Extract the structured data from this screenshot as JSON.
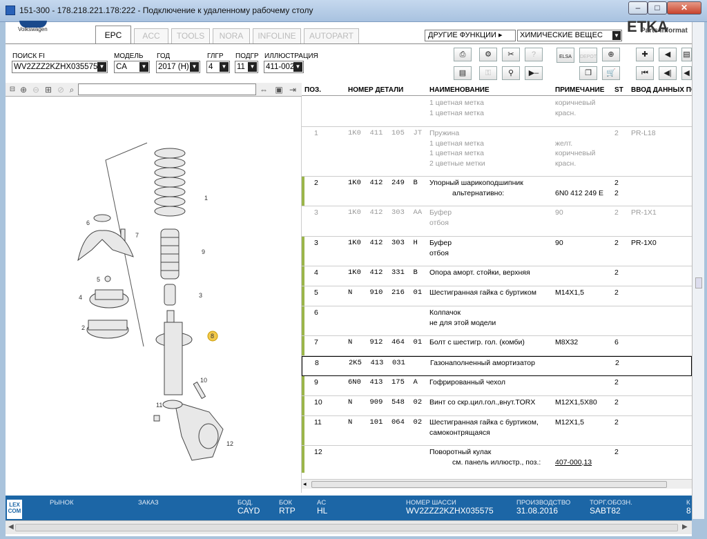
{
  "window": {
    "title": "151-300 - 178.218.221.178:222 - Подключение к удаленному рабочему столу",
    "btn_min": "–",
    "btn_max": "□",
    "btn_close": "✕"
  },
  "brand": {
    "name": "Volkswagen",
    "right_text": "Parts Informat",
    "right_logo": "ETKA"
  },
  "tabs": [
    "EPC",
    "ACC",
    "TOOLS",
    "NORA",
    "INFOLINE",
    "AUTOPART"
  ],
  "other_functions": {
    "label": "ДРУГИЕ ФУНКЦИИ ▸",
    "value": "ХИМИЧЕСКИЕ ВЕЩЕС"
  },
  "filters": [
    {
      "label": "ПОИСК FI",
      "value": "WV2ZZZ2KZHX035575"
    },
    {
      "label": "МОДЕЛЬ",
      "value": "CA"
    },
    {
      "label": "ГОД",
      "value": "2017 (H)"
    },
    {
      "label": "ГЛГР",
      "value": "4"
    },
    {
      "label": "ПОДГР",
      "value": "11"
    },
    {
      "label": "ИЛЛЮСТРАЦИЯ",
      "value": "411-002"
    }
  ],
  "toolbar_labels": {
    "elsa": "ELSA",
    "depot": "DEPOT"
  },
  "columns": [
    "ПОЗ.",
    "НОМЕР ДЕТАЛИ",
    "НАИМЕНОВАНИЕ",
    "ПРИМЕЧАНИЕ",
    "ST",
    "ВВОД ДАННЫХ ПО"
  ],
  "rows": [
    {
      "pos": "",
      "part": "",
      "name": "1 цветная метка\n1 цветная метка",
      "note": "коричневый\nкрасн.",
      "st": "",
      "input": "",
      "style": "gray"
    },
    {
      "pos": "1",
      "part": "1K0  411  105  JT",
      "name": "Пружина\n1 цветная метка\n1 цветная метка\n2 цветные метки",
      "note": "\nжелт.\nкоричневый\nкрасн.",
      "st": "2",
      "input": "PR-L18",
      "style": "gray"
    },
    {
      "pos": "2",
      "part": "1K0  412  249  B",
      "name": "Упорный шарикоподшипник",
      "name2": "альтернативно:",
      "note": "\n6N0 412 249 E",
      "st": "2\n2",
      "input": "",
      "style": "green"
    },
    {
      "pos": "3",
      "part": "1K0  412  303  AA",
      "name": "Буфер\nотбоя",
      "note": "90",
      "st": "2",
      "input": "PR-1X1",
      "style": "gray"
    },
    {
      "pos": "3",
      "part": "1K0  412  303  H",
      "name": "Буфер\nотбоя",
      "note": "90",
      "st": "2",
      "input": "PR-1X0",
      "style": "green"
    },
    {
      "pos": "4",
      "part": "1K0  412  331  B",
      "name": "Опора аморт. стойки, верхняя",
      "note": "",
      "st": "2",
      "input": "",
      "style": "green"
    },
    {
      "pos": "5",
      "part": "N    910  216  01",
      "name": "Шестигранная гайка с буртиком",
      "note": "M14X1,5",
      "st": "2",
      "input": "",
      "style": "green"
    },
    {
      "pos": "6",
      "part": "",
      "name": "Колпачок\nне для этой модели",
      "note": "",
      "st": "",
      "input": "",
      "style": "green"
    },
    {
      "pos": "7",
      "part": "N    912  464  01",
      "name": "Болт с шестигр. гол. (комби)",
      "note": "M8X32",
      "st": "6",
      "input": "",
      "style": "green"
    },
    {
      "pos": "8",
      "part": "2K5  413  031",
      "name": "Газонаполненный амортизатор",
      "note": "",
      "st": "2",
      "input": "",
      "style": "sel"
    },
    {
      "pos": "9",
      "part": "6N0  413  175  A",
      "name": "Гофрированный чехол",
      "note": "",
      "st": "2",
      "input": "",
      "style": "green"
    },
    {
      "pos": "10",
      "part": "N    909  548  02",
      "name": "Винт со скр.цил.гол.,внут.TORX",
      "note": "M12X1,5X80",
      "st": "2",
      "input": "",
      "style": "green"
    },
    {
      "pos": "11",
      "part": "N    101  064  02",
      "name": "Шестигранная гайка с буртиком,\nсамоконтрящаяся",
      "note": "M12X1,5",
      "st": "2",
      "input": "",
      "style": "green"
    },
    {
      "pos": "12",
      "part": "",
      "name": "Поворотный кулак",
      "name2": "см. панель иллюстр., поз.:",
      "note": "\n407-000,13",
      "st": "2",
      "input": "",
      "style": "green"
    }
  ],
  "illustration_labels": [
    "1",
    "2",
    "3",
    "4",
    "5",
    "6",
    "7",
    "8",
    "9",
    "10",
    "11",
    "12"
  ],
  "status": {
    "logo": "LEX\nCOM",
    "market_label": "РЫНОК",
    "order_label": "ЗАКАЗ",
    "bod_label": "БОД.",
    "bod_value": "CAYD",
    "bok_label": "БОК",
    "bok_value": "RTP",
    "ac_label": "AC",
    "ac_value": "HL",
    "chassis_label": "НОМЕР ШАССИ",
    "chassis_value": "WV2ZZZ2KZHX035575",
    "prod_label": "ПРОИЗВОДСТВО",
    "prod_value": "31.08.2016",
    "torg_label": "ТОРГ.ОБОЗН.",
    "torg_value": "SABT82",
    "k_label": "К",
    "k_value": "8"
  }
}
